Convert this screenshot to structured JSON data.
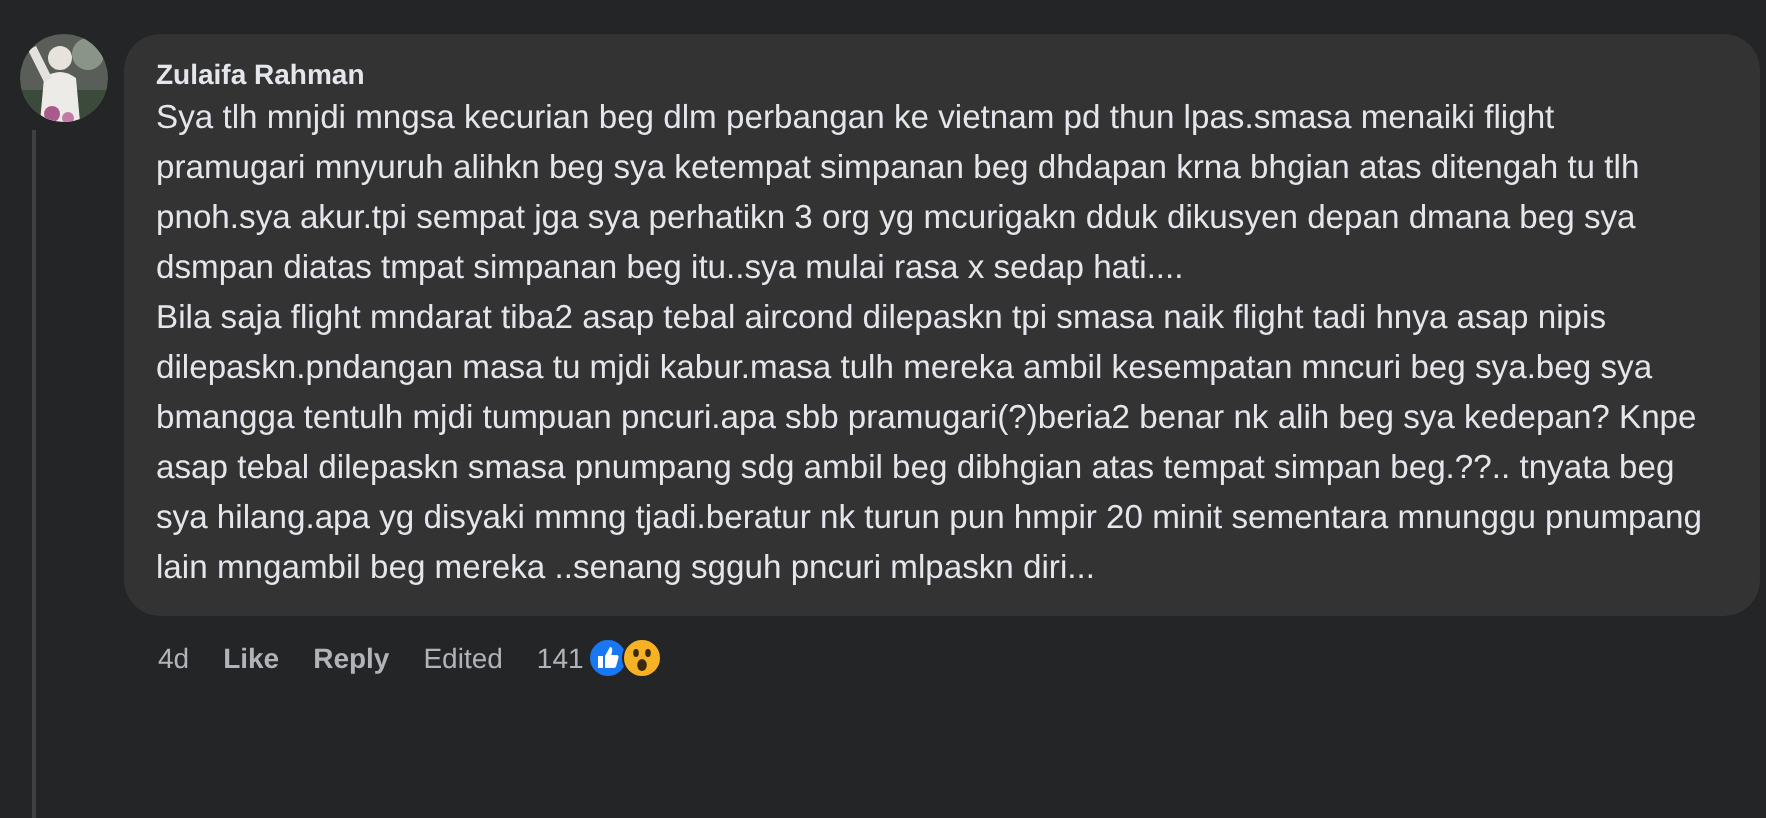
{
  "comment": {
    "author": "Zulaifa Rahman",
    "paragraphs": [
      "Sya tlh mnjdi mngsa kecurian beg dlm perbangan ke vietnam pd thun lpas.smasa menaiki flight pramugari mnyuruh alihkn beg sya ketempat simpanan beg dhdapan krna bhgian atas ditengah tu tlh pnoh.sya akur.tpi sempat jga sya perhatikn 3 org yg mcurigakn dduk dikusyen depan dmana beg sya dsmpan diatas tmpat simpanan beg itu..sya mulai rasa x sedap hati....",
      "Bila saja flight mndarat tiba2 asap tebal aircond dilepaskn tpi smasa naik flight tadi hnya asap nipis dilepaskn.pndangan masa tu mjdi kabur.masa tulh mereka ambil kesempatan mncuri beg sya.beg sya bmangga tentulh mjdi tumpuan pncuri.apa sbb pramugari(?)beria2 benar nk alih beg sya kedepan? Knpe asap tebal dilepaskn smasa pnumpang sdg ambil beg dibhgian atas tempat simpan beg.??.. tnyata beg sya hilang.apa yg disyaki mmng tjadi.beratur nk turun pun hmpir 20 minit sementara mnunggu pnumpang lain mngambil beg mereka ..senang sgguh pncuri mlpaskn diri..."
    ],
    "time": "4d",
    "actions": [
      {
        "kind": "like",
        "label": "Like"
      },
      {
        "kind": "reply",
        "label": "Reply"
      },
      {
        "kind": "edited",
        "label": "Edited"
      }
    ],
    "reaction_count": "141",
    "reactions": [
      {
        "kind": "like"
      },
      {
        "kind": "wow"
      }
    ]
  }
}
